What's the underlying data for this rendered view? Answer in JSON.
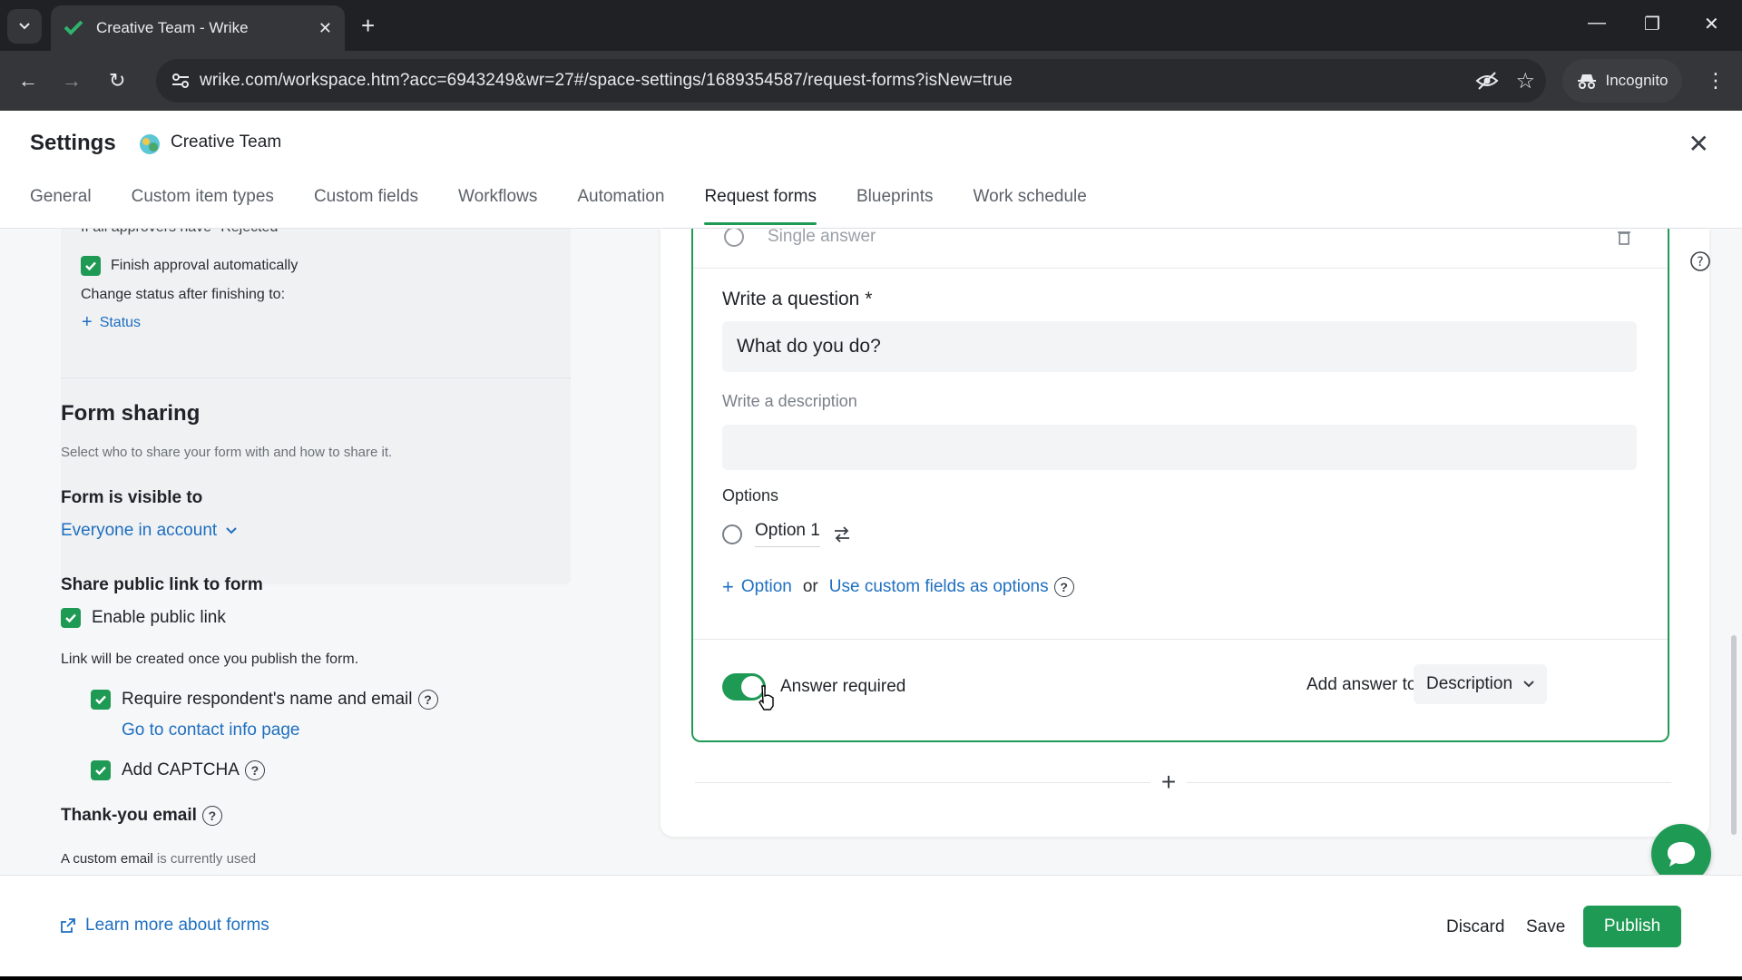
{
  "browser": {
    "tab_title": "Creative Team - Wrike",
    "url": "wrike.com/workspace.htm?acc=6943249&wr=27#/space-settings/1689354587/request-forms?isNew=true",
    "incognito_label": "Incognito"
  },
  "header": {
    "title": "Settings",
    "space_name": "Creative Team",
    "tabs": [
      {
        "label": "General"
      },
      {
        "label": "Custom item types"
      },
      {
        "label": "Custom fields"
      },
      {
        "label": "Workflows"
      },
      {
        "label": "Automation"
      },
      {
        "label": "Request forms",
        "active": true
      },
      {
        "label": "Blueprints"
      },
      {
        "label": "Work schedule"
      }
    ]
  },
  "approval": {
    "cut_text": "If all approvers have \"Rejected\"",
    "finish_auto_label": "Finish approval automatically",
    "finish_auto_checked": true,
    "change_status_label": "Change status after finishing to:",
    "status_link": "Status"
  },
  "form_sharing": {
    "title": "Form sharing",
    "subtitle": "Select who to share your form with and how to share it.",
    "visible_to_label": "Form is visible to",
    "visible_to_value": "Everyone in account",
    "public_link_title": "Share public link to form",
    "enable_public_link_label": "Enable public link",
    "enable_public_link_checked": true,
    "link_note": "Link will be created once you publish the form.",
    "require_name_email_label": "Require respondent's name and email",
    "require_name_email_checked": true,
    "contact_info_link": "Go to contact info page",
    "captcha_label": "Add CAPTCHA",
    "captcha_checked": true,
    "thank_you_title": "Thank-you email",
    "custom_email_note_bold": "A custom email",
    "custom_email_note_rest": " is currently used"
  },
  "question": {
    "type_label": "Single answer",
    "write_question_label": "Write a question *",
    "question_value": "What do you do?",
    "description_placeholder": "Write a description",
    "options_label": "Options",
    "option_1": "Option 1",
    "add_option_label": "Option",
    "or_label": "or",
    "custom_fields_link": "Use custom fields as options",
    "answer_required_label": "Answer required",
    "answer_required_on": true,
    "add_answer_to_label": "Add answer to",
    "add_answer_to_value": "Description"
  },
  "footer": {
    "learn_more": "Learn more about forms",
    "discard": "Discard",
    "save": "Save",
    "publish": "Publish"
  },
  "colors": {
    "accent_green": "#1f9a55",
    "link_blue": "#1f6fc0"
  }
}
